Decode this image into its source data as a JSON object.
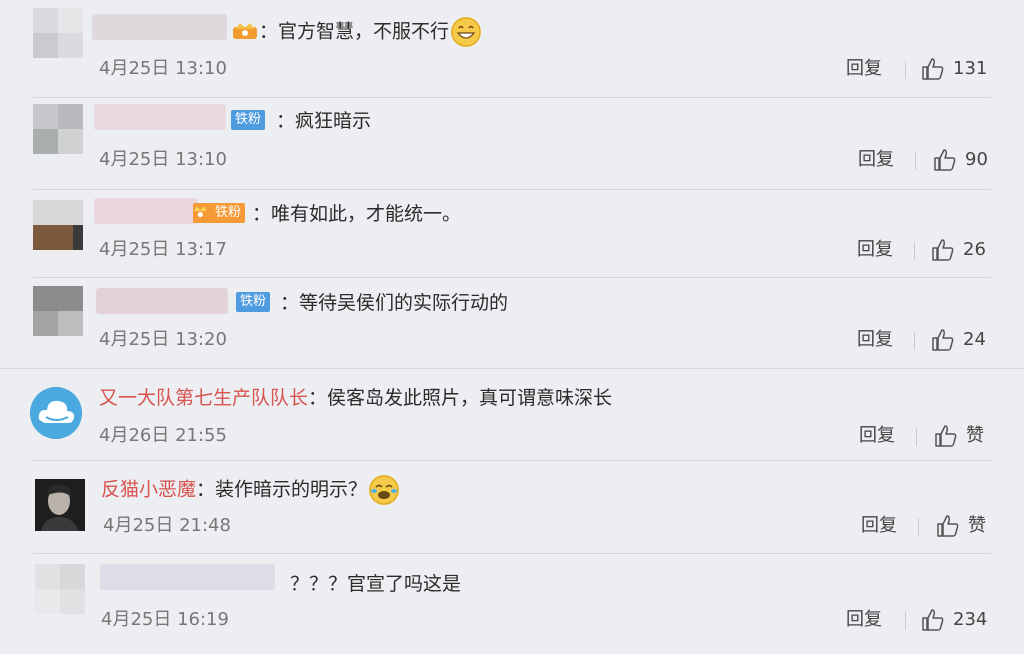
{
  "reply_label": "回复",
  "comments": [
    {
      "badge": "",
      "content": "官方智慧，不服不行",
      "time": "4月25日 13:10",
      "likes": "131"
    },
    {
      "badge": "铁粉",
      "content": "疯狂暗示",
      "time": "4月25日 13:10",
      "likes": "90"
    },
    {
      "badge": "铁粉",
      "content": "唯有如此，才能统一。",
      "time": "4月25日 13:17",
      "likes": "26"
    },
    {
      "badge": "铁粉",
      "content": "等待吴侯们的实际行动的",
      "time": "4月25日 13:20",
      "likes": "24"
    },
    {
      "user": "又一大队第七生产队队长",
      "content": "侯客岛发此照片，真可谓意味深长",
      "time": "4月26日 21:55",
      "likes": "赞"
    },
    {
      "user": "反猫小恶魔",
      "content": "装作暗示的明示？",
      "time": "4月25日 21:48",
      "likes": "赞"
    },
    {
      "badge": "",
      "content": "？？？官宣了吗这是",
      "time": "4月25日 16:19",
      "likes": "234"
    }
  ]
}
